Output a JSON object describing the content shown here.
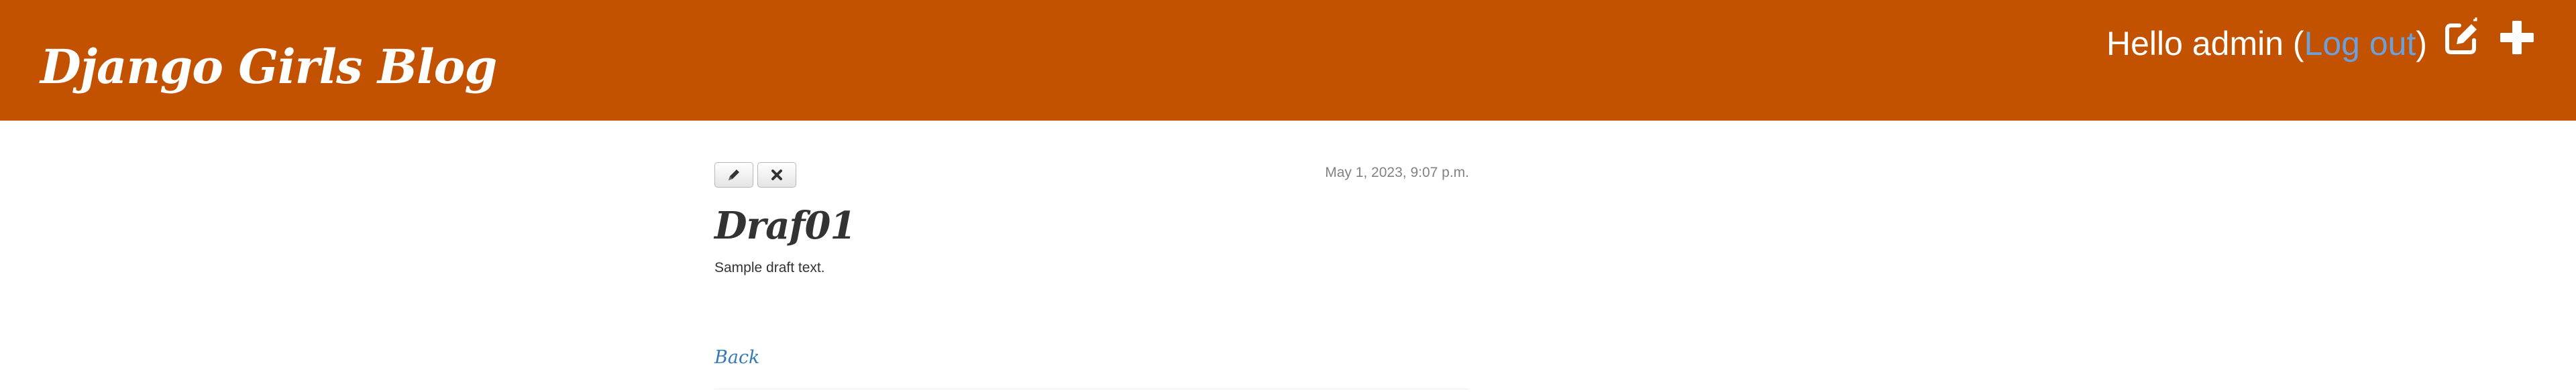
{
  "header": {
    "site_title": "Django Girls Blog",
    "greeting": "Hello admin (",
    "logout_label": "Log out",
    "greeting_close": ")",
    "icons": [
      "edit-draft-icon",
      "plus-icon"
    ],
    "background_color": "#c25100"
  },
  "post": {
    "date": "May 1, 2023, 9:07 p.m.",
    "title": "Draf01",
    "text": "Sample draft text.",
    "actions": [
      "pencil-icon",
      "remove-icon"
    ]
  },
  "navigation": {
    "back_label": "Back"
  },
  "colors": {
    "link": "#337ab7",
    "logout_link": "#6f9fd8",
    "text": "#333333",
    "date": "#828282"
  }
}
